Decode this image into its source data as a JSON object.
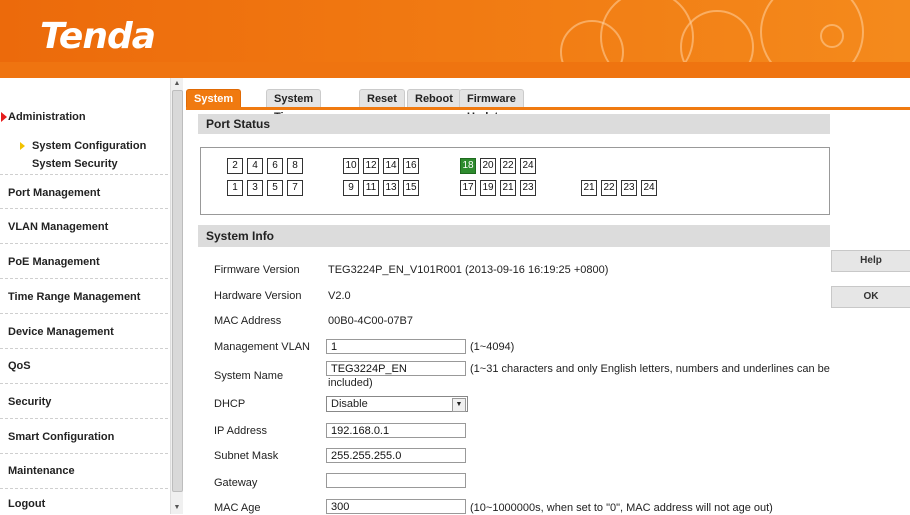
{
  "brand": {
    "logo_text": "Tenda",
    "accent_color": "#f07a10"
  },
  "sidebar": {
    "items": [
      {
        "label": "Administration"
      },
      {
        "label": "Port Management"
      },
      {
        "label": "VLAN Management"
      },
      {
        "label": "PoE Management"
      },
      {
        "label": "Time Range Management"
      },
      {
        "label": "Device Management"
      },
      {
        "label": "QoS"
      },
      {
        "label": "Security"
      },
      {
        "label": "Smart Configuration"
      },
      {
        "label": "Maintenance"
      },
      {
        "label": "Logout"
      }
    ],
    "subitems": [
      {
        "label": "System Configuration"
      },
      {
        "label": "System Security"
      }
    ]
  },
  "tabs": [
    {
      "label": "System Info"
    },
    {
      "label": "System Time"
    },
    {
      "label": "Reset"
    },
    {
      "label": "Reboot"
    },
    {
      "label": "Firmware Update"
    }
  ],
  "port_status": {
    "title": "Port Status",
    "top_row": [
      "2",
      "4",
      "6",
      "8",
      "10",
      "12",
      "14",
      "16",
      "18",
      "20",
      "22",
      "24"
    ],
    "bottom_row": [
      "1",
      "3",
      "5",
      "7",
      "9",
      "11",
      "13",
      "15",
      "17",
      "19",
      "21",
      "23"
    ],
    "sfp_row": [
      "21",
      "22",
      "23",
      "24"
    ],
    "up_port": "18",
    "up_color": "#2e8b2e"
  },
  "system_info": {
    "title": "System Info",
    "firmware_label": "Firmware Version",
    "firmware_value": "TEG3224P_EN_V101R001 (2013-09-16 16:19:25 +0800)",
    "hardware_label": "Hardware Version",
    "hardware_value": "V2.0",
    "mac_label": "MAC Address",
    "mac_value": "00B0-4C00-07B7",
    "mgmt_vlan_label": "Management VLAN",
    "mgmt_vlan_value": "1",
    "mgmt_vlan_hint": "(1~4094)",
    "sysname_label": "System Name",
    "sysname_value": "TEG3224P_EN",
    "sysname_hint": "(1~31 characters and only English letters, numbers and underlines can be",
    "sysname_hint2": "included)",
    "dhcp_label": "DHCP",
    "dhcp_value": "Disable",
    "ip_label": "IP Address",
    "ip_value": "192.168.0.1",
    "mask_label": "Subnet Mask",
    "mask_value": "255.255.255.0",
    "gateway_label": "Gateway",
    "gateway_value": "",
    "macage_label": "MAC Age",
    "macage_value": "300",
    "macage_hint": "(10~1000000s, when set to \"0\", MAC address will not age out)"
  },
  "buttons": {
    "help": "Help",
    "ok": "OK"
  }
}
